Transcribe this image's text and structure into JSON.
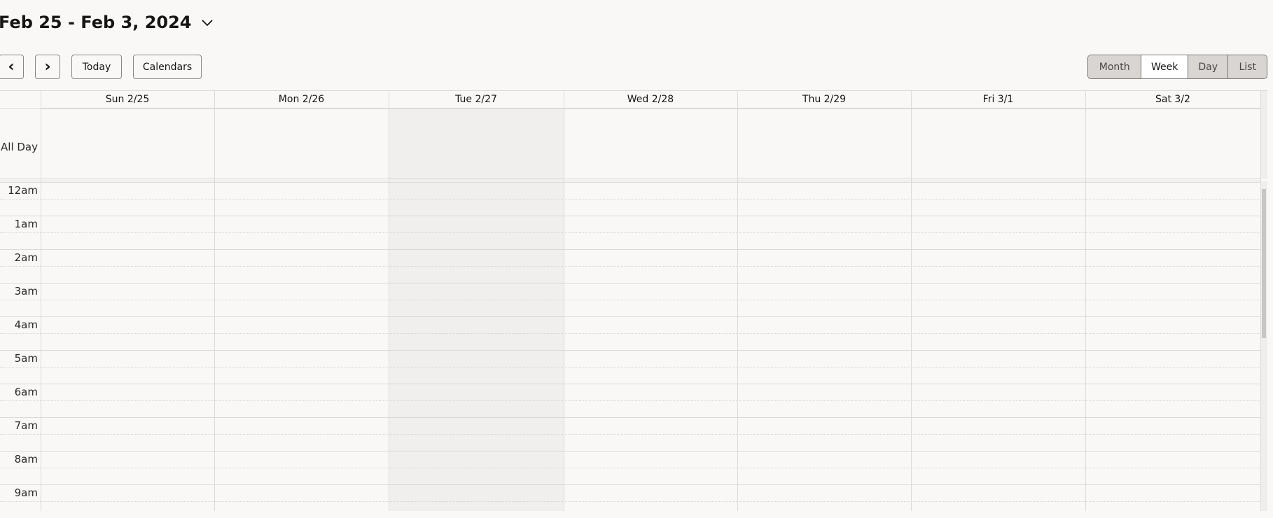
{
  "header": {
    "title": "Feb 25 - Feb 3, 2024"
  },
  "toolbar": {
    "prev": "‹",
    "next": "›",
    "today": "Today",
    "calendars": "Calendars"
  },
  "views": [
    {
      "label": "Month",
      "active": false
    },
    {
      "label": "Week",
      "active": true
    },
    {
      "label": "Day",
      "active": false
    },
    {
      "label": "List",
      "active": false
    }
  ],
  "days": [
    "Sun 2/25",
    "Mon 2/26",
    "Tue 2/27",
    "Wed 2/28",
    "Thu 2/29",
    "Fri 3/1",
    "Sat 3/2"
  ],
  "today_index": 2,
  "all_day_label": "All Day",
  "hours": [
    "12am",
    "1am",
    "2am",
    "3am",
    "4am",
    "5am",
    "6am",
    "7am",
    "8am",
    "9am"
  ],
  "colors": {
    "background": "#f9f8f6",
    "today": "#f0efed",
    "border": "#dcdad7"
  }
}
